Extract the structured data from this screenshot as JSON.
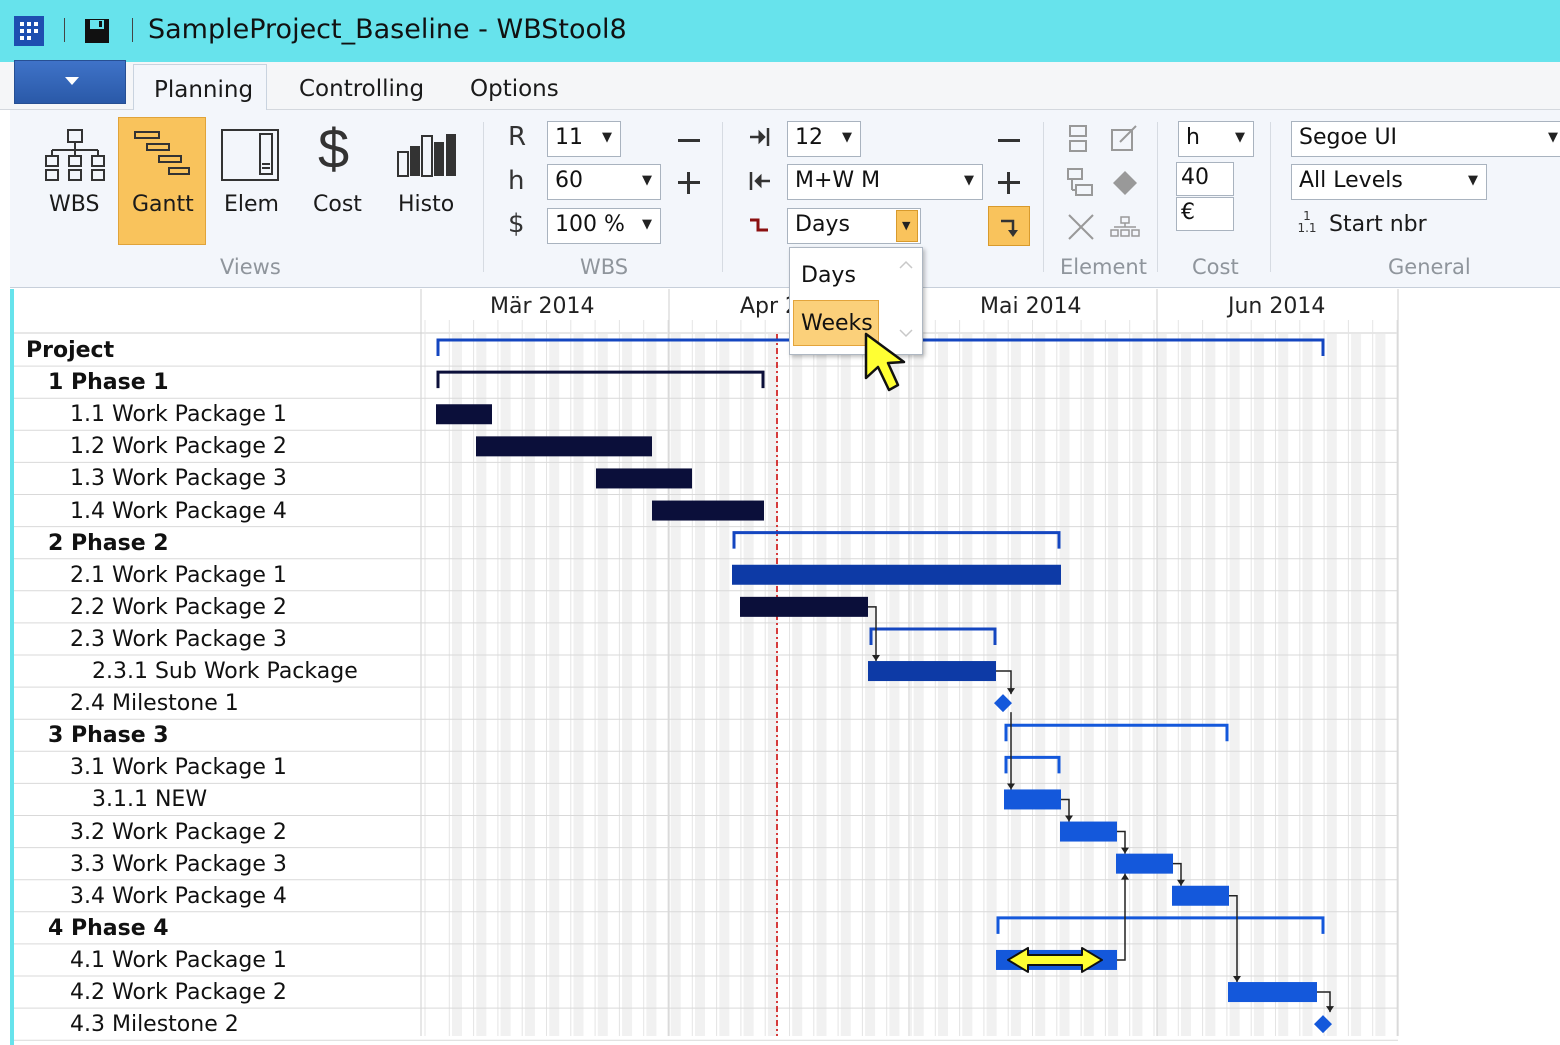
{
  "window": {
    "title": "SampleProject_Baseline - WBStool8"
  },
  "tabs": [
    {
      "label": "Planning",
      "active": true
    },
    {
      "label": "Controlling",
      "active": false
    },
    {
      "label": "Options",
      "active": false
    }
  ],
  "ribbon": {
    "views": {
      "group_label": "Views",
      "buttons": [
        {
          "label": "WBS",
          "icon": "wbs-tree-icon"
        },
        {
          "label": "Gantt",
          "icon": "gantt-icon",
          "active": true
        },
        {
          "label": "Elem",
          "icon": "element-icon"
        },
        {
          "label": "Cost",
          "icon": "dollar-icon"
        },
        {
          "label": "Histo",
          "icon": "histogram-icon"
        }
      ]
    },
    "wbs": {
      "group_label": "WBS",
      "row_label": "R",
      "row_value": "11",
      "height_label": "h",
      "height_value": "60",
      "cost_label": "$",
      "cost_value": "100 %"
    },
    "timescale": {
      "tick_value": "12",
      "scale_value": "M+W M",
      "unit_value": "Days",
      "dropdown_options": [
        "Days",
        "Weeks"
      ],
      "highlighted_option": "Weeks"
    },
    "element": {
      "group_label": "Element"
    },
    "cost": {
      "group_label": "Cost",
      "unit_value": "h",
      "hours_value": "40",
      "currency_value": "€"
    },
    "general": {
      "group_label": "General",
      "font_value": "Segoe UI",
      "levels_value": "All Levels",
      "start_nbr_label": "Start nbr",
      "start_nbr_icon_text": "1\n1.1"
    }
  },
  "gantt": {
    "months": [
      "Mär 2014",
      "Apr 2014",
      "Mai 2014",
      "Jun 2014"
    ],
    "month_visible": [
      "Mär 2014",
      "Apr 2",
      "Mai 2014",
      "Jun 2014"
    ],
    "rows": [
      {
        "label": "Project",
        "level": 0,
        "bold": true
      },
      {
        "label": "1 Phase 1",
        "level": 1,
        "bold": true
      },
      {
        "label": "1.1 Work Package 1",
        "level": 2
      },
      {
        "label": "1.2 Work Package 2",
        "level": 2
      },
      {
        "label": "1.3 Work Package 3",
        "level": 2
      },
      {
        "label": "1.4 Work Package 4",
        "level": 2
      },
      {
        "label": "2 Phase 2",
        "level": 1,
        "bold": true
      },
      {
        "label": "2.1 Work Package 1",
        "level": 2
      },
      {
        "label": "2.2 Work Package 2",
        "level": 2
      },
      {
        "label": "2.3 Work Package 3",
        "level": 2
      },
      {
        "label": "2.3.1 Sub Work Package",
        "level": 3
      },
      {
        "label": "2.4 Milestone 1",
        "level": 2
      },
      {
        "label": "3 Phase 3",
        "level": 1,
        "bold": true
      },
      {
        "label": "3.1 Work Package 1",
        "level": 2
      },
      {
        "label": "3.1.1 NEW",
        "level": 3
      },
      {
        "label": "3.2 Work Package 2",
        "level": 2
      },
      {
        "label": "3.3 Work Package 3",
        "level": 2
      },
      {
        "label": "3.4 Work Package 4",
        "level": 2
      },
      {
        "label": "4 Phase 4",
        "level": 1,
        "bold": true
      },
      {
        "label": "4.1 Work Package 1",
        "level": 2
      },
      {
        "label": "4.2 Work Package 2",
        "level": 2
      },
      {
        "label": "4.3 Milestone 2",
        "level": 2
      }
    ]
  },
  "colors": {
    "titlebar": "#67e3ec",
    "active_orange": "#f9c35c",
    "bar_dark": "#0b0f3a",
    "bar_blue_dark": "#0d3aa6",
    "bar_blue": "#1458db",
    "milestone": "#1458db",
    "today_line": "#cc0000",
    "cursor_yellow": "#ffff33"
  }
}
